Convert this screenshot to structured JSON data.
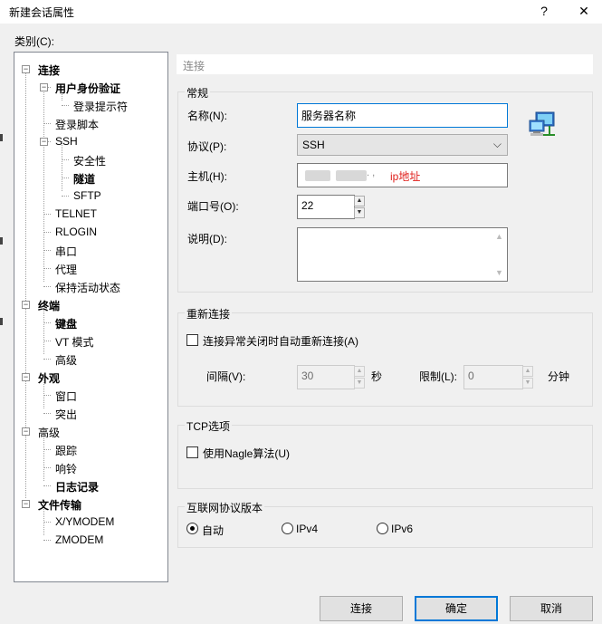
{
  "window": {
    "title": "新建会话属性",
    "help": "?",
    "close": "✕"
  },
  "category_label": "类别(C):",
  "tree": [
    {
      "label": "连接",
      "depth": 0,
      "bold": true,
      "toggle": "−"
    },
    {
      "label": "用户身份验证",
      "depth": 1,
      "bold": true,
      "toggle": "−"
    },
    {
      "label": "登录提示符",
      "depth": 2,
      "bold": false
    },
    {
      "label": "登录脚本",
      "depth": 1,
      "bold": false
    },
    {
      "label": "SSH",
      "depth": 1,
      "bold": false,
      "toggle": "−"
    },
    {
      "label": "安全性",
      "depth": 2,
      "bold": false
    },
    {
      "label": "隧道",
      "depth": 2,
      "bold": true
    },
    {
      "label": "SFTP",
      "depth": 2,
      "bold": false
    },
    {
      "label": "TELNET",
      "depth": 1,
      "bold": false
    },
    {
      "label": "RLOGIN",
      "depth": 1,
      "bold": false
    },
    {
      "label": "串口",
      "depth": 1,
      "bold": false
    },
    {
      "label": "代理",
      "depth": 1,
      "bold": false
    },
    {
      "label": "保持活动状态",
      "depth": 1,
      "bold": false
    },
    {
      "label": "终端",
      "depth": 0,
      "bold": true,
      "toggle": "−"
    },
    {
      "label": "键盘",
      "depth": 1,
      "bold": true
    },
    {
      "label": "VT 模式",
      "depth": 1,
      "bold": false
    },
    {
      "label": "高级",
      "depth": 1,
      "bold": false
    },
    {
      "label": "外观",
      "depth": 0,
      "bold": true,
      "toggle": "−"
    },
    {
      "label": "窗口",
      "depth": 1,
      "bold": false
    },
    {
      "label": "突出",
      "depth": 1,
      "bold": false
    },
    {
      "label": "高级",
      "depth": 0,
      "bold": false,
      "toggle": "−"
    },
    {
      "label": "跟踪",
      "depth": 1,
      "bold": false
    },
    {
      "label": "响铃",
      "depth": 1,
      "bold": false
    },
    {
      "label": "日志记录",
      "depth": 1,
      "bold": true
    },
    {
      "label": "文件传输",
      "depth": 0,
      "bold": true,
      "toggle": "−"
    },
    {
      "label": "X/YMODEM",
      "depth": 1,
      "bold": false
    },
    {
      "label": "ZMODEM",
      "depth": 1,
      "bold": false
    }
  ],
  "section_header": "连接",
  "general": {
    "title": "常规",
    "name_label": "名称(N):",
    "name_value": "服务器名称",
    "protocol_label": "协议(P):",
    "protocol_value": "SSH",
    "host_label": "主机(H):",
    "host_visible_fragment": ". ,",
    "host_annotation": "ip地址",
    "annotation_color": "#e0201c",
    "port_label": "端口号(O):",
    "port_value": "22",
    "desc_label": "说明(D):"
  },
  "reconnect": {
    "title": "重新连接",
    "checkbox_label": "连接异常关闭时自动重新连接(A)",
    "checked": false,
    "interval_label": "间隔(V):",
    "interval_value": "30",
    "interval_unit": "秒",
    "limit_label": "限制(L):",
    "limit_value": "0",
    "limit_unit": "分钟"
  },
  "tcp": {
    "title": "TCP选项",
    "nagle_label": "使用Nagle算法(U)",
    "checked": false
  },
  "ipver": {
    "title": "互联网协议版本",
    "options": [
      "自动",
      "IPv4",
      "IPv6"
    ],
    "selected": "自动"
  },
  "buttons": {
    "connect": "连接",
    "ok": "确定",
    "cancel": "取消"
  },
  "colors": {
    "focus_border": "#0078d7",
    "window_bg": "#f0f0f0"
  }
}
